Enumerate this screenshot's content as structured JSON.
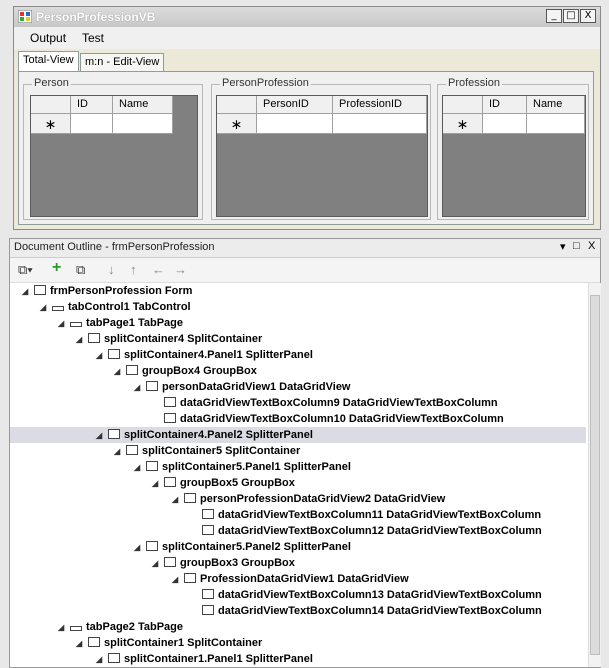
{
  "form": {
    "title": "PersonProfessionVB",
    "window_buttons": [
      "_",
      "□",
      "X"
    ],
    "menu": [
      "Output",
      "Test"
    ],
    "tabs": [
      "Total-View",
      "m:n - Edit-View"
    ],
    "groups": [
      {
        "title": "Person",
        "columns": [
          "ID",
          "Name"
        ],
        "new_row_marker": "∗"
      },
      {
        "title": "PersonProfession",
        "columns": [
          "PersonID",
          "ProfessionID"
        ],
        "new_row_marker": "∗"
      },
      {
        "title": "Profession",
        "columns": [
          "ID",
          "Name"
        ],
        "new_row_marker": "∗"
      }
    ]
  },
  "outline": {
    "title": "Document Outline - frmPersonProfession",
    "title_buttons": [
      "▾",
      "□",
      "X"
    ],
    "toolbar": [
      "view-icon",
      "add-icon",
      "copy-icon",
      "move-down-icon",
      "move-up-icon",
      "move-left-icon",
      "move-right-icon"
    ],
    "nodes": [
      {
        "text": "frmPersonProfession  Form",
        "icon": "form-icon"
      },
      {
        "text": "tabControl1  TabControl",
        "icon": "tabcontrol-icon"
      },
      {
        "text": "tabPage1  TabPage",
        "icon": "tabpage-icon"
      },
      {
        "text": "splitContainer4  SplitContainer",
        "icon": "splitcontainer-icon"
      },
      {
        "text": "splitContainer4.Panel1  SplitterPanel",
        "icon": "splitterpanel-icon"
      },
      {
        "text": "groupBox4  GroupBox",
        "icon": "groupbox-icon"
      },
      {
        "text": "personDataGridView1  DataGridView",
        "icon": "datagridview-icon"
      },
      {
        "text": "dataGridViewTextBoxColumn9  DataGridViewTextBoxColumn",
        "icon": "textboxcolumn-icon"
      },
      {
        "text": "dataGridViewTextBoxColumn10  DataGridViewTextBoxColumn",
        "icon": "textboxcolumn-icon"
      },
      {
        "text": "splitContainer4.Panel2  SplitterPanel",
        "icon": "splitterpanel-icon"
      },
      {
        "text": "splitContainer5  SplitContainer",
        "icon": "splitcontainer-icon"
      },
      {
        "text": "splitContainer5.Panel1  SplitterPanel",
        "icon": "splitterpanel-icon"
      },
      {
        "text": "groupBox5  GroupBox",
        "icon": "groupbox-icon"
      },
      {
        "text": "personProfessionDataGridView2  DataGridView",
        "icon": "datagridview-icon"
      },
      {
        "text": "dataGridViewTextBoxColumn11  DataGridViewTextBoxColumn",
        "icon": "textboxcolumn-icon"
      },
      {
        "text": "dataGridViewTextBoxColumn12  DataGridViewTextBoxColumn",
        "icon": "textboxcolumn-icon"
      },
      {
        "text": "splitContainer5.Panel2  SplitterPanel",
        "icon": "splitterpanel-icon"
      },
      {
        "text": "groupBox3  GroupBox",
        "icon": "groupbox-icon"
      },
      {
        "text": "ProfessionDataGridView1  DataGridView",
        "icon": "datagridview-icon"
      },
      {
        "text": "dataGridViewTextBoxColumn13  DataGridViewTextBoxColumn",
        "icon": "textboxcolumn-icon"
      },
      {
        "text": "dataGridViewTextBoxColumn14  DataGridViewTextBoxColumn",
        "icon": "textboxcolumn-icon"
      },
      {
        "text": "tabPage2  TabPage",
        "icon": "tabpage-icon"
      },
      {
        "text": "splitContainer1  SplitContainer",
        "icon": "splitcontainer-icon"
      },
      {
        "text": "splitContainer1.Panel1  SplitterPanel",
        "icon": "splitterpanel-icon"
      }
    ],
    "selected_node": "splitContainer4.Panel2  SplitterPanel"
  }
}
